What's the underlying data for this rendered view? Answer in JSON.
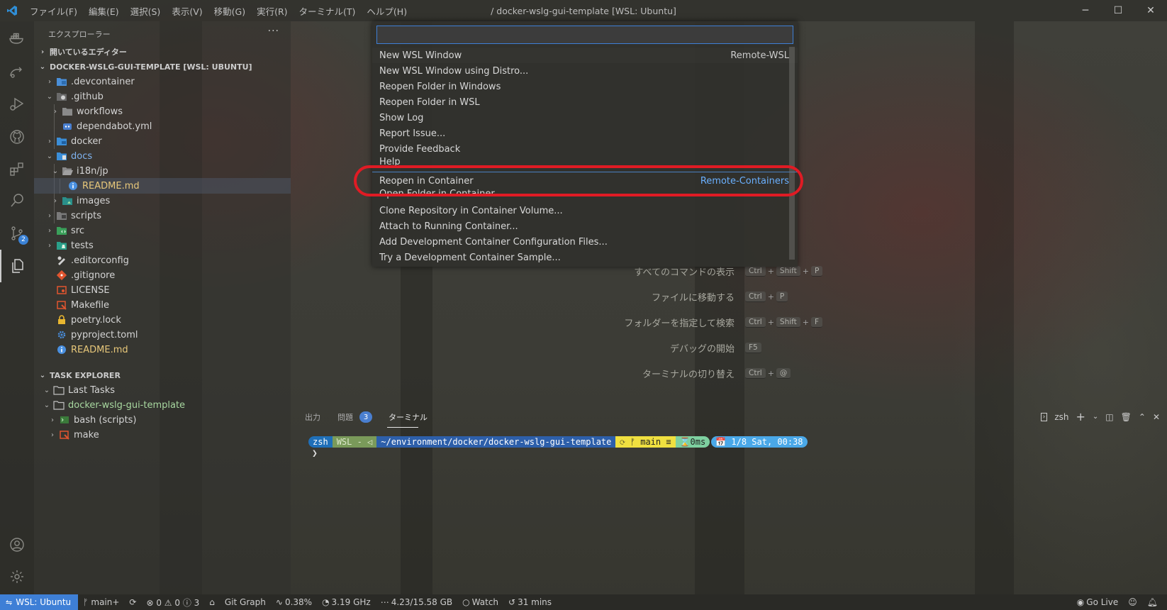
{
  "window": {
    "title": "/ docker-wslg-gui-template [WSL: Ubuntu]",
    "menu": [
      "ファイル(F)",
      "編集(E)",
      "選択(S)",
      "表示(V)",
      "移動(G)",
      "実行(R)",
      "ターミナル(T)",
      "ヘルプ(H)"
    ],
    "controls": {
      "minimize": "─",
      "maximize": "☐",
      "close": "✕"
    }
  },
  "activity_bar": {
    "scm_badge": "2"
  },
  "sidebar": {
    "title": "エクスプローラー",
    "more": "···",
    "open_editors": "開いているエディター",
    "workspace": "DOCKER-WSLG-GUI-TEMPLATE [WSL: UBUNTU]",
    "tree": [
      {
        "label": ".devcontainer",
        "chev": "›"
      },
      {
        "label": ".github",
        "chev": "⌄"
      },
      {
        "label": "workflows",
        "chev": "›"
      },
      {
        "label": "dependabot.yml",
        "chev": ""
      },
      {
        "label": "docker",
        "chev": "›"
      },
      {
        "label": "docs",
        "chev": "⌄"
      },
      {
        "label": "i18n/jp",
        "chev": "⌄"
      },
      {
        "label": "README.md",
        "chev": ""
      },
      {
        "label": "images",
        "chev": "›"
      },
      {
        "label": "scripts",
        "chev": "›"
      },
      {
        "label": "src",
        "chev": "›"
      },
      {
        "label": "tests",
        "chev": "›"
      },
      {
        "label": ".editorconfig",
        "chev": ""
      },
      {
        "label": ".gitignore",
        "chev": ""
      },
      {
        "label": "LICENSE",
        "chev": ""
      },
      {
        "label": "Makefile",
        "chev": ""
      },
      {
        "label": "poetry.lock",
        "chev": ""
      },
      {
        "label": "pyproject.toml",
        "chev": ""
      },
      {
        "label": "README.md",
        "chev": ""
      }
    ],
    "task_explorer": "TASK EXPLORER",
    "tasks": [
      {
        "label": "Last Tasks",
        "chev": "⌄"
      },
      {
        "label": "docker-wslg-gui-template",
        "chev": "⌄"
      },
      {
        "label": "bash (scripts)",
        "chev": "›"
      },
      {
        "label": "make",
        "chev": "›"
      }
    ]
  },
  "command_palette": {
    "input_value": "",
    "items": [
      {
        "label": "New WSL Window",
        "detail": "Remote-WSL"
      },
      {
        "label": "New WSL Window using Distro...",
        "detail": ""
      },
      {
        "label": "Reopen Folder in Windows",
        "detail": ""
      },
      {
        "label": "Reopen Folder in WSL",
        "detail": ""
      },
      {
        "label": "Show Log",
        "detail": ""
      },
      {
        "label": "Report Issue...",
        "detail": ""
      },
      {
        "label": "Provide Feedback",
        "detail": ""
      },
      {
        "label": "Help",
        "detail": ""
      },
      {
        "label": "Reopen in Container",
        "detail": "Remote-Containers"
      },
      {
        "label": "Open Folder in Container...",
        "detail": ""
      },
      {
        "label": "Clone Repository in Container Volume...",
        "detail": ""
      },
      {
        "label": "Attach to Running Container...",
        "detail": ""
      },
      {
        "label": "Add Development Container Configuration Files...",
        "detail": ""
      },
      {
        "label": "Try a Development Container Sample...",
        "detail": ""
      }
    ]
  },
  "welcome_shortcuts": [
    {
      "label": "すべてのコマンドの表示",
      "keys": [
        "Ctrl",
        "Shift",
        "P"
      ]
    },
    {
      "label": "ファイルに移動する",
      "keys": [
        "Ctrl",
        "P"
      ]
    },
    {
      "label": "フォルダーを指定して検索",
      "keys": [
        "Ctrl",
        "Shift",
        "F"
      ]
    },
    {
      "label": "デバッグの開始",
      "keys": [
        "F5"
      ]
    },
    {
      "label": "ターミナルの切り替え",
      "keys": [
        "Ctrl",
        "@"
      ]
    }
  ],
  "panel": {
    "tabs": [
      "出力",
      "問題",
      "ターミナル"
    ],
    "problems_count": "3",
    "terminal_name": "zsh",
    "prompt": {
      "shell": "zsh",
      "wsl": "WSL - ◁",
      "path": "~/environment/docker/docker-wslg-gui-template",
      "git": "⟳ ᚠ main ≡",
      "time": "⌛0ms",
      "date": "📅 1/8 Sat, 00:38",
      "cursor": "❯"
    }
  },
  "statusbar": {
    "remote": "WSL: Ubuntu",
    "branch": "main+",
    "sync": "⟳",
    "problems": "⊗ 0 ⚠ 0 ⓘ 3",
    "home": "⌂",
    "git_graph": "Git Graph",
    "cpu": "0.38%",
    "freq": "3.19 GHz",
    "mem": "4.23/15.58 GB",
    "watch": "Watch",
    "time": "31 mins",
    "go_live": "Go Live"
  },
  "colors": {
    "accent": "#3e7fd6",
    "highlight": "#e01b24"
  }
}
